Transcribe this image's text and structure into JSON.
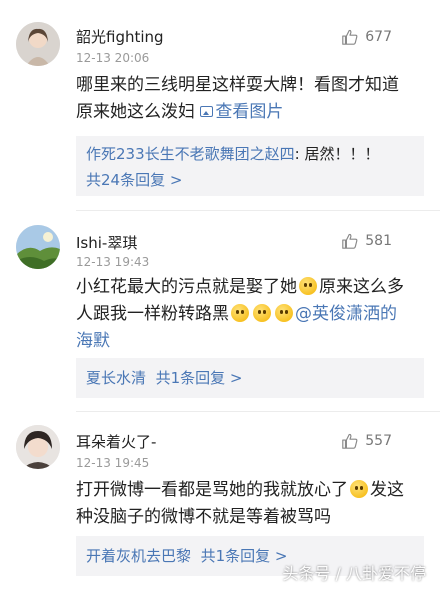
{
  "comments": [
    {
      "username": "韶光fighting",
      "time": "12-13 20:06",
      "likes": "677",
      "text_1": "哪里来的三线明星这样耍大牌！看图才知道",
      "text_2": "原来她这么泼妇",
      "image_link": "查看图片",
      "reply_author": "作死233长生不老歌舞团之赵四",
      "reply_text": ": 居然！！！",
      "replies_count": "共24条回复 >"
    },
    {
      "username": "Ishi-翠琪",
      "time": "12-13 19:43",
      "likes": "581",
      "text_1": "小红花最大的污点就是娶了她",
      "text_2": "原来这么多",
      "text_3": "人跟我一样粉转路黑",
      "mention": "@英俊潇洒的",
      "text_4": "海默",
      "reply_author": "夏长水清",
      "replies_count": "共1条回复 >"
    },
    {
      "username": "耳朵着火了-",
      "time": "12-13 19:45",
      "likes": "557",
      "text_1": "打开微博一看都是骂她的我就放心了",
      "text_2": "发这",
      "text_3": "种没脑子的微博不就是等着被骂吗",
      "reply_author": "开着灰机去巴黎",
      "replies_count": "共1条回复 >"
    }
  ],
  "watermark": "头条号 / 八卦爱不停",
  "icons": {
    "like": "thumbs-up-icon",
    "emoji": "smiley-emoji-icon",
    "image": "image-icon"
  },
  "colors": {
    "link": "#4a77b5",
    "reply_bg": "#f3f3f5",
    "time": "#9a9a9a"
  }
}
